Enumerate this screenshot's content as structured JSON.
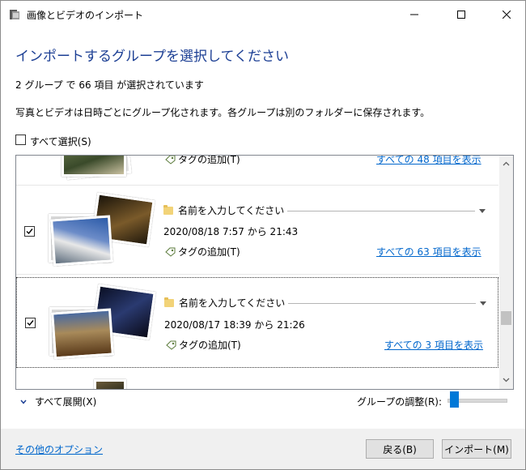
{
  "window": {
    "title": "画像とビデオのインポート"
  },
  "heading": "インポートするグループを選択してください",
  "summary": "2 グループ で 66 項目 が選択されています",
  "description": "写真とビデオは日時ごとにグループ化されます。各グループは別のフォルダーに保存されます。",
  "select_all": {
    "label": "すべて選択(S)",
    "checked": false
  },
  "partial_group": {
    "tag_label": "タグの追加(T)",
    "link": "すべての 48 項目を表示"
  },
  "groups": [
    {
      "name_placeholder": "名前を入力してください",
      "date": "2020/08/18 7:57 から 21:43",
      "tag_label": "タグの追加(T)",
      "link": "すべての 63 項目を表示",
      "checked": true
    },
    {
      "name_placeholder": "名前を入力してください",
      "date": "2020/08/17 18:39 から 21:26",
      "tag_label": "タグの追加(T)",
      "link": "すべての 3 項目を表示",
      "checked": true
    }
  ],
  "expand_all": "すべて展開(X)",
  "group_adjust": "グループの調整(R):",
  "footer": {
    "options_link": "その他のオプション",
    "back_button": "戻る(B)",
    "import_button": "インポート(M)"
  },
  "colors": {
    "heading": "#1c3f94",
    "link": "#0066cc",
    "accent": "#0078d7"
  }
}
